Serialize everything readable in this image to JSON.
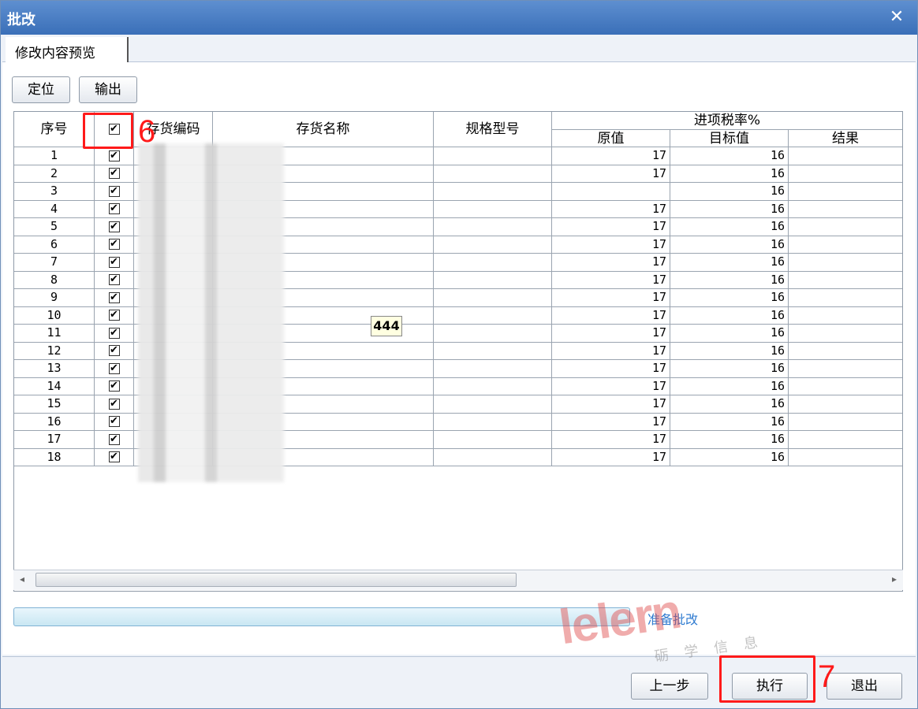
{
  "window": {
    "title": "批改",
    "close_glyph": "✕"
  },
  "tab": {
    "label": "修改内容预览"
  },
  "toolbar": {
    "locate_label": "定位",
    "export_label": "输出"
  },
  "grid": {
    "headers": {
      "seq": "序号",
      "code": "存货编码",
      "name": "存货名称",
      "spec": "规格型号",
      "tax_group": "进项税率%",
      "orig": "原值",
      "target": "目标值",
      "result": "结果"
    },
    "header_checked": true,
    "rows": [
      {
        "seq": "1",
        "checked": true,
        "orig": "17",
        "target": "16"
      },
      {
        "seq": "2",
        "checked": true,
        "orig": "17",
        "target": "16"
      },
      {
        "seq": "3",
        "checked": true,
        "orig": "",
        "target": "16"
      },
      {
        "seq": "4",
        "checked": true,
        "orig": "17",
        "target": "16"
      },
      {
        "seq": "5",
        "checked": true,
        "orig": "17",
        "target": "16"
      },
      {
        "seq": "6",
        "checked": true,
        "orig": "17",
        "target": "16"
      },
      {
        "seq": "7",
        "checked": true,
        "orig": "17",
        "target": "16"
      },
      {
        "seq": "8",
        "checked": true,
        "orig": "17",
        "target": "16"
      },
      {
        "seq": "9",
        "checked": true,
        "orig": "17",
        "target": "16"
      },
      {
        "seq": "10",
        "checked": true,
        "orig": "17",
        "target": "16"
      },
      {
        "seq": "11",
        "checked": true,
        "orig": "17",
        "target": "16"
      },
      {
        "seq": "12",
        "checked": true,
        "orig": "17",
        "target": "16"
      },
      {
        "seq": "13",
        "checked": true,
        "orig": "17",
        "target": "16"
      },
      {
        "seq": "14",
        "checked": true,
        "orig": "17",
        "target": "16"
      },
      {
        "seq": "15",
        "checked": true,
        "orig": "17",
        "target": "16"
      },
      {
        "seq": "16",
        "checked": true,
        "orig": "17",
        "target": "16"
      },
      {
        "seq": "17",
        "checked": true,
        "orig": "17",
        "target": "16"
      },
      {
        "seq": "18",
        "checked": true,
        "orig": "17",
        "target": "16"
      }
    ],
    "tooltip": "444"
  },
  "status": {
    "text": "准备批改"
  },
  "footer": {
    "prev_label": "上一步",
    "execute_label": "执行",
    "exit_label": "退出"
  },
  "annotations": {
    "mark6": "6",
    "mark7": "7"
  },
  "watermark": {
    "logo": "lelern",
    "sub": "砺学信息"
  },
  "colors": {
    "title_bar": "#4a7fc4",
    "annotation": "#ff1a1a",
    "status": "#2f7bd0"
  }
}
